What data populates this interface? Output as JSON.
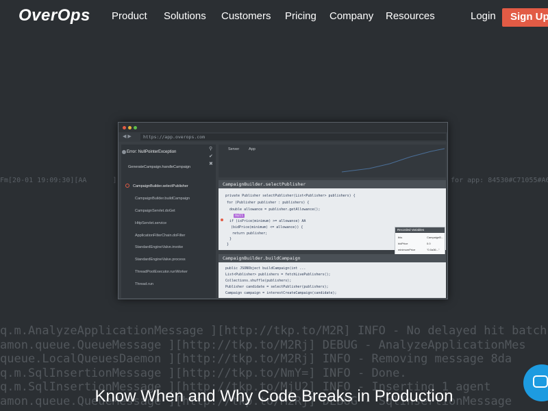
{
  "nav": {
    "logo": "OverOps",
    "items": [
      "Product",
      "Solutions",
      "Customers",
      "Pricing",
      "Company",
      "Resources"
    ],
    "login": "Login",
    "signup": "Sign Up"
  },
  "background_log": {
    "mid_line_left": "Fm[20-01 19:09:30][AA",
    "mid_line_center": "][c.s",
    "mid_line_right": "s for app: 84530#C71055#A683",
    "big_lines": [
      "q.m.AnalyzeApplicationMessage ][http://tkp.to/M2R] INFO  - No delayed hit batch",
      "amon.queue.QueueMessage       ][http://tkp.to/M2Rj] DEBUG - AnalyzeApplicationMes",
      "queue.LocalQueuesDaemon       ][http://tkp.to/M2Rj] INFO  - Removing message 8da",
      "q.m.SqlInsertionMessage       ][http://tkp.to/NmY=] INFO  - Done.",
      "q.m.SqlInsertionMessage       ][http://tkp.to/MjU2] INFO  - Inserting 1 agent",
      "amon.queue.QueueMessage       ][http://tkp.to/M2Rj] DEBUG - SqlInsertionMessage"
    ]
  },
  "app_window": {
    "url": "https://app.overops.com",
    "error_title": "Error: NullPointerException",
    "error_subtitle": "GenerateCampaign.handleCampaign",
    "stack": [
      "CampaignBuilder.selectPublisher",
      "CampaignBuilder.buildCampaign",
      "CampaignServlet.doGet",
      "HttpServlet.service",
      "ApplicationFilterChain.doFilter",
      "StandardEngineValve.invoke",
      "StandardEngineValve.process",
      "ThreadPoolExecutor.runWorker",
      "Thread.run"
    ],
    "top_labels": [
      "Server",
      "App"
    ],
    "code_block_1": {
      "title": "CampaignBuilder.selectPublisher",
      "lines": [
        "private Publisher selectPublisher(List<Publisher> publishers) {",
        "  for (Publisher publisher : publishers) {",
        "    double allowance = publisher.getAllowance();",
        "null",
        "if (isPrice(minimum) >= allowance) AA",
        "  (bidPrice(minimum) <= allowance)) {",
        "    return publisher;",
        "  }",
        "}"
      ]
    },
    "variables": {
      "title": "Recorded Variables",
      "rows": [
        {
          "name": "this",
          "value": "CampaignB..."
        },
        {
          "name": "bidPrice",
          "value": "0.0"
        },
        {
          "name": "minimumPrice",
          "value": "\"0.0a36...\""
        },
        {
          "name": "levels",
          "value": "\"70.5007..\""
        },
        {
          "name": "allowance",
          "value": "0.2"
        },
        {
          "name": "publisher",
          "value": "Publisher"
        }
      ]
    },
    "code_block_2": {
      "title": "CampaignBuilder.buildCampaign",
      "lines": [
        "public JSONObject buildCampaign(int ...",
        "  List<Publisher> publishers = fetchLivePublishers();",
        "  Collections.shuffle(publishers);",
        "  Publisher candidate = selectPublisher(publishers);",
        "  Campaign campaign = interestCreateCampaign(candidate);"
      ]
    }
  },
  "headline": "Know When and Why Code Breaks in Production",
  "colors": {
    "background": "#2b2f33",
    "signup": "#e25b45",
    "chat": "#1d9be0"
  }
}
